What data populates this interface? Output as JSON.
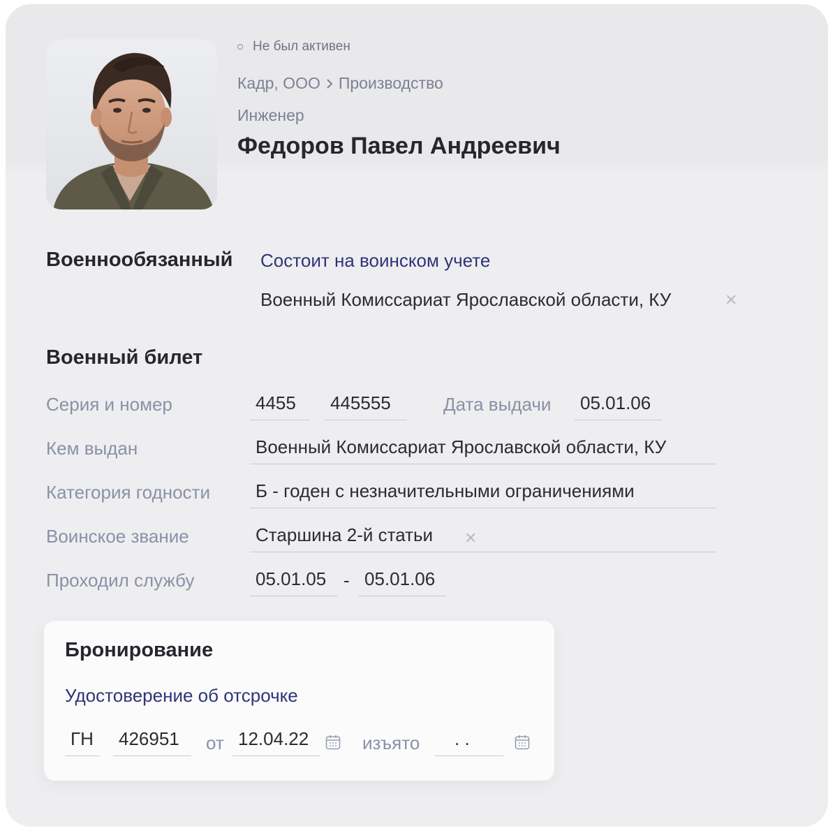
{
  "profile": {
    "status": "Не был активен",
    "breadcrumb": [
      "Кадр, ООО",
      "Производство"
    ],
    "position": "Инженер",
    "full_name": "Федоров Павел Андреевич"
  },
  "military": {
    "title": "Военнообязанный",
    "registration_status": "Состоит на воинском учете",
    "commissariat": "Военный Комиссариат Ярославской области, КУ"
  },
  "ticket": {
    "title": "Военный билет",
    "series_number_label": "Серия и номер",
    "series": "4455",
    "number": "445555",
    "issue_date_label": "Дата выдачи",
    "issue_date": "05.01.06",
    "issued_by_label": "Кем выдан",
    "issued_by": "Военный Комиссариат Ярославской области, КУ",
    "fitness_label": "Категория годности",
    "fitness": "Б - годен с незначительными ограничениями",
    "rank_label": "Воинское звание",
    "rank": "Старшина 2-й статьи",
    "service_label": "Проходил службу",
    "service_from": "05.01.05",
    "service_sep": "-",
    "service_to": "05.01.06"
  },
  "booking": {
    "title": "Бронирование",
    "document_type": "Удостоверение об отсрочке",
    "series": "ГН",
    "number": "426951",
    "from_label": "от",
    "from_date": "12.04.22",
    "withdrawn_label": "изъято",
    "withdrawn_date": ". ."
  },
  "icons": {
    "status": "status-dot-icon",
    "breadcrumb_separator": "chevron-right-icon",
    "clear": "close-icon",
    "date": "calendar-icon"
  },
  "colors": {
    "card_background": "#eeeef0",
    "link": "#2f3477",
    "label": "#8a91a6",
    "text": "#2b2b31"
  }
}
